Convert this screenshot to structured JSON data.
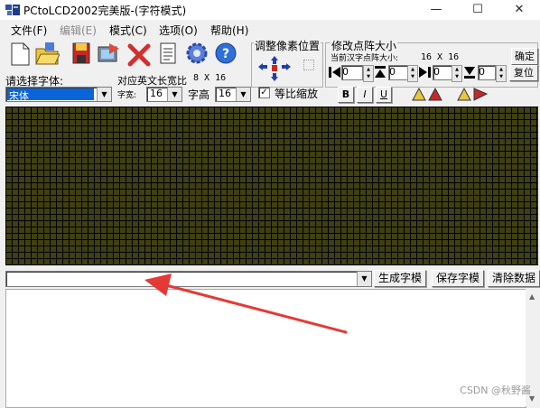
{
  "window": {
    "title": "PCtoLCD2002完美版-(字符模式)",
    "controls": {
      "minimize": "—",
      "maximize": "☐",
      "close": "✕"
    }
  },
  "menu": [
    "文件(F)",
    "编辑(E)",
    "模式(C)",
    "选项(O)",
    "帮助(H)"
  ],
  "toolbar": {
    "adjust_label": "调整像素位置",
    "resize_label": "修改点阵大小",
    "current_size_label": "当前汉字点阵大小:",
    "current_size_value": "16 X 16",
    "confirm_label": "确定",
    "restore_label": "复位",
    "spin_values": [
      "0",
      "0",
      "0",
      "0"
    ]
  },
  "font": {
    "select_label": "请选择字体:",
    "selected": "宋体",
    "ratio_label": "对应英文长宽比",
    "ratio_value": "8 X 16",
    "width_label": "字宽:",
    "width_value": "16",
    "height_label": "字高",
    "height_value": "16",
    "scale_label": "等比缩放",
    "scale_checked": "✓",
    "bold": "B",
    "italic": "I",
    "underline": "U"
  },
  "actions": {
    "generate": "生成字模",
    "save": "保存字模",
    "clear": "清除数据"
  },
  "input": {
    "value": ""
  },
  "watermark": "CSDN @秋野酱",
  "colors": {
    "grid_fill": "#3f3f14",
    "grid_line": "#000000",
    "arrow": "#e53935"
  }
}
